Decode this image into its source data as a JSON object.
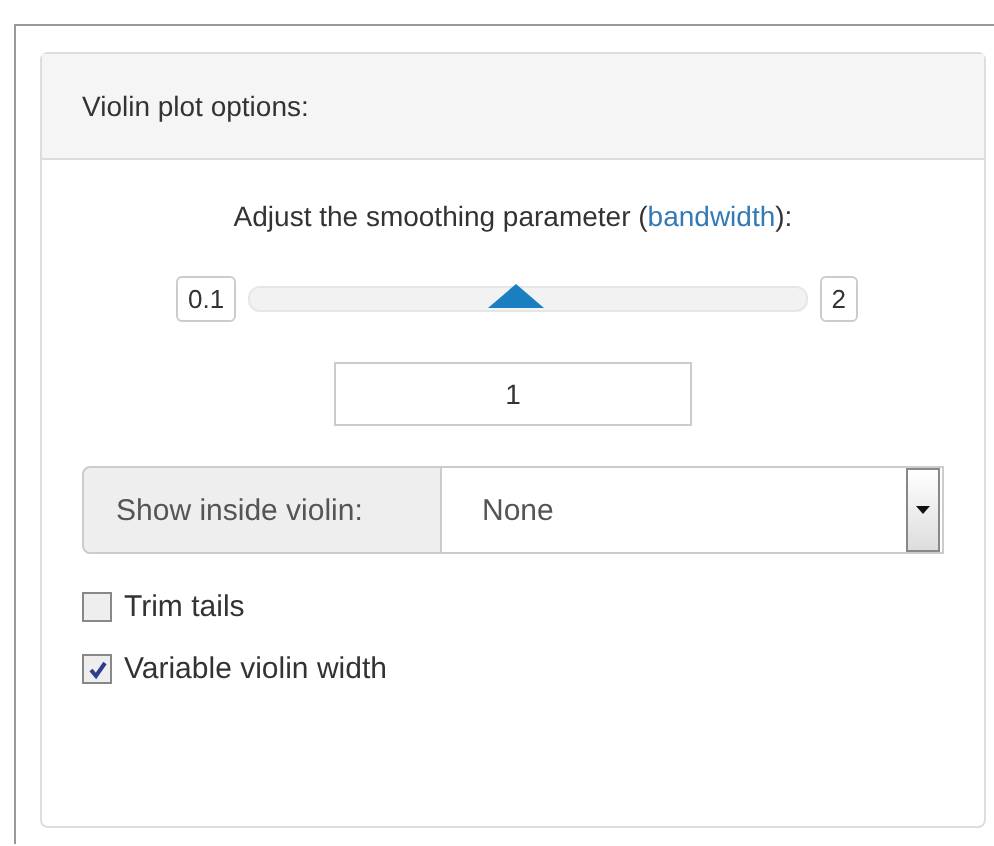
{
  "panel": {
    "title": "Violin plot options:"
  },
  "bandwidth": {
    "label": "Adjust the smoothing parameter (",
    "link": "bandwidth",
    "label_end": "):",
    "min": "0.1",
    "max": "2",
    "level": 0.48,
    "value": "1"
  },
  "select": {
    "label": "Show inside violin:",
    "value": "None"
  },
  "checkboxes": [
    {
      "label": "Trim tails",
      "checked": false
    },
    {
      "label": "Variable violin width",
      "checked": true
    }
  ]
}
